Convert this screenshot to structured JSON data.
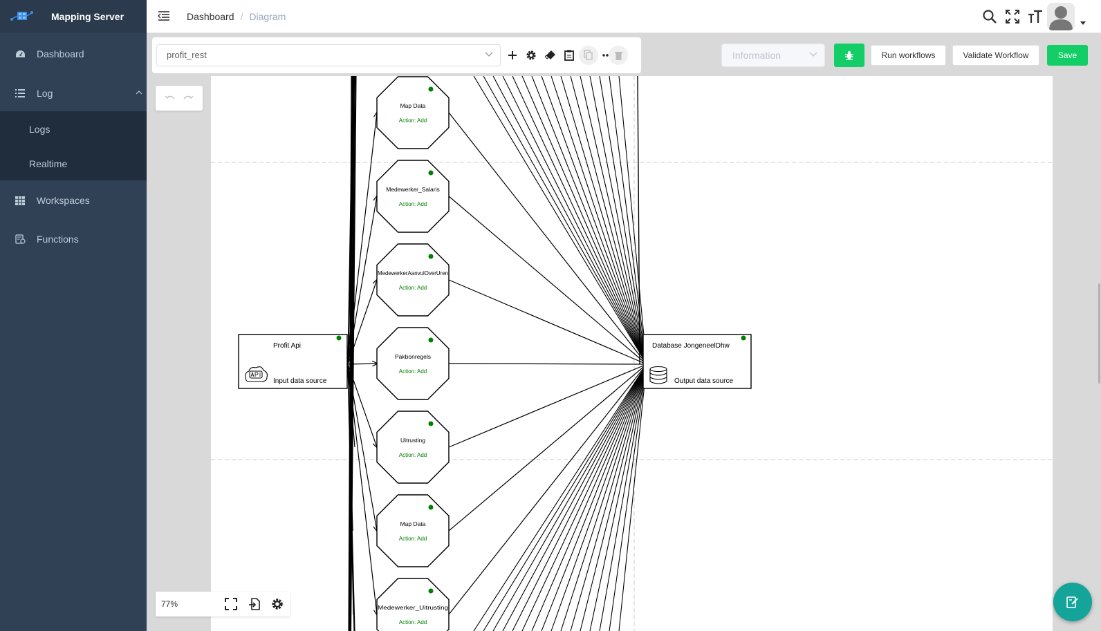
{
  "app": {
    "title": "Mapping Server"
  },
  "sidebar": {
    "items": [
      {
        "label": "Dashboard",
        "icon": "dashboard-icon"
      },
      {
        "label": "Log",
        "icon": "list-icon"
      },
      {
        "label": "Workspaces",
        "icon": "grid-icon"
      },
      {
        "label": "Functions",
        "icon": "functions-icon"
      }
    ],
    "log_children": [
      {
        "label": "Logs"
      },
      {
        "label": "Realtime"
      }
    ]
  },
  "navbar": {
    "breadcrumb": [
      "Dashboard",
      "Diagram"
    ],
    "icons": [
      "search-icon",
      "fullscreen-icon",
      "text-size-icon",
      "avatar"
    ]
  },
  "toolbar": {
    "workflow_value": "profit_rest",
    "icons": [
      "add-icon",
      "settings-icon",
      "eraser-icon",
      "clipboard-icon",
      "copy-icon",
      "more-icon",
      "trash-icon"
    ]
  },
  "actions": {
    "level_placeholder": "Information",
    "run_label": "Run workflows",
    "validate_label": "Validate Workflow",
    "save_label": "Save",
    "debug_icon": "bug-icon"
  },
  "zoom": {
    "value": "77%"
  },
  "diagram": {
    "source": {
      "title": "Profit Api",
      "subtitle": "Input data source",
      "icon": "api-icon"
    },
    "target": {
      "title": "Database JongeneelDhw",
      "subtitle": "Output data source",
      "icon": "database-icon"
    },
    "nodes": [
      {
        "title": "Map Data",
        "action": "Action: Add"
      },
      {
        "title": "Medewerker_Salaris",
        "action": "Action: Add"
      },
      {
        "title": "MedewerkerAanvulOverUren",
        "action": "Action: Add"
      },
      {
        "title": "Pakbonregels",
        "action": "Action: Add"
      },
      {
        "title": "Uitrusting",
        "action": "Action: Add"
      },
      {
        "title": "Map Data",
        "action": "Action: Add"
      },
      {
        "title": "Medewerker_Uitrusting",
        "action": "Action: Add"
      }
    ]
  },
  "colors": {
    "sidebar": "#304156",
    "accent_green": "#13ce66",
    "fab": "#15a49a",
    "status_dot": "#008000",
    "action_text": "#008000"
  }
}
